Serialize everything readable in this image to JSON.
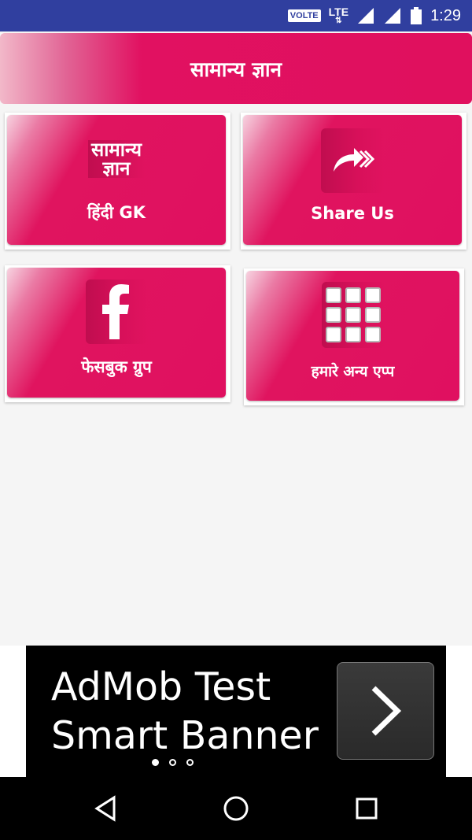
{
  "status_bar": {
    "volte": "VOLTE",
    "lte": "LTE",
    "time": "1:29",
    "icons": [
      "signal-icon",
      "signal-icon",
      "battery-icon"
    ]
  },
  "app_bar": {
    "title": "सामान्य ज्ञान"
  },
  "cards": [
    {
      "label": "हिंदी GK",
      "logo_line1": "सामान्य",
      "logo_line2": "ज्ञान",
      "icon": "app-logo-icon"
    },
    {
      "label": "Share Us",
      "icon": "share-arrow-icon"
    },
    {
      "label": "फेसबुक ग्रुप",
      "icon": "facebook-icon"
    },
    {
      "label": "हमारे अन्य एप्प",
      "icon": "apps-grid-icon"
    }
  ],
  "ad_banner": {
    "line1": "AdMob Test",
    "line2": "Smart Banner",
    "icon": "chevron-right-icon",
    "pager_dots": 3,
    "active_dot": 0
  },
  "nav_bar": {
    "icons": [
      "back-icon",
      "home-icon",
      "recents-icon"
    ]
  },
  "colors": {
    "status_bar": "#303f9f",
    "accent": "#e0105e",
    "background": "#f5f5f5"
  }
}
